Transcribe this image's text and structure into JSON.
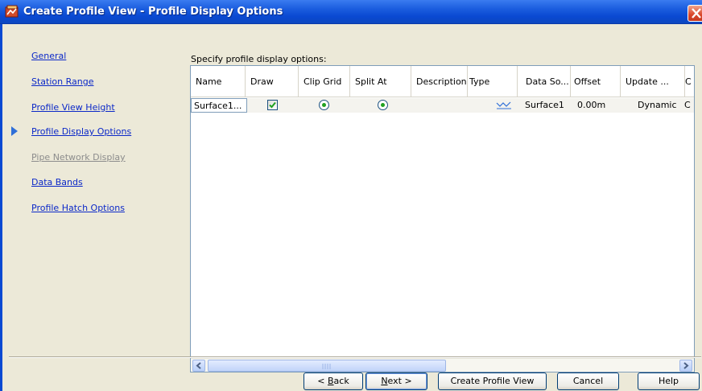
{
  "window": {
    "title": "Create Profile View - Profile Display Options",
    "title_bg": "#0a49d2",
    "close_icon": "close-icon"
  },
  "nav": {
    "items": [
      {
        "label": "General",
        "state": "link"
      },
      {
        "label": "Station Range",
        "state": "link"
      },
      {
        "label": "Profile View Height",
        "state": "link"
      },
      {
        "label": "Profile Display Options",
        "state": "current"
      },
      {
        "label": "Pipe Network Display",
        "state": "disabled"
      },
      {
        "label": "Data Bands",
        "state": "link"
      },
      {
        "label": "Profile Hatch Options",
        "state": "link"
      }
    ]
  },
  "main": {
    "instruction": "Specify profile display options:",
    "columns": [
      "Name",
      "Draw",
      "Clip Grid",
      "Split At",
      "Description",
      "Type",
      "Data So...",
      "Offset",
      "Update ...",
      "C"
    ],
    "rows": [
      {
        "name": "Surface1...",
        "draw": true,
        "clip_grid": true,
        "split_at": true,
        "description": "",
        "type_icon": "profile-type-icon",
        "data_source": "Surface1",
        "offset": "0.00m",
        "update": "Dynamic",
        "extra": "C"
      }
    ]
  },
  "buttons": {
    "back": {
      "pre": "< ",
      "key": "B",
      "post": "ack"
    },
    "next": {
      "pre": "",
      "key": "N",
      "post": "ext >"
    },
    "create": "Create Profile View",
    "cancel": "Cancel",
    "help": "Help"
  }
}
